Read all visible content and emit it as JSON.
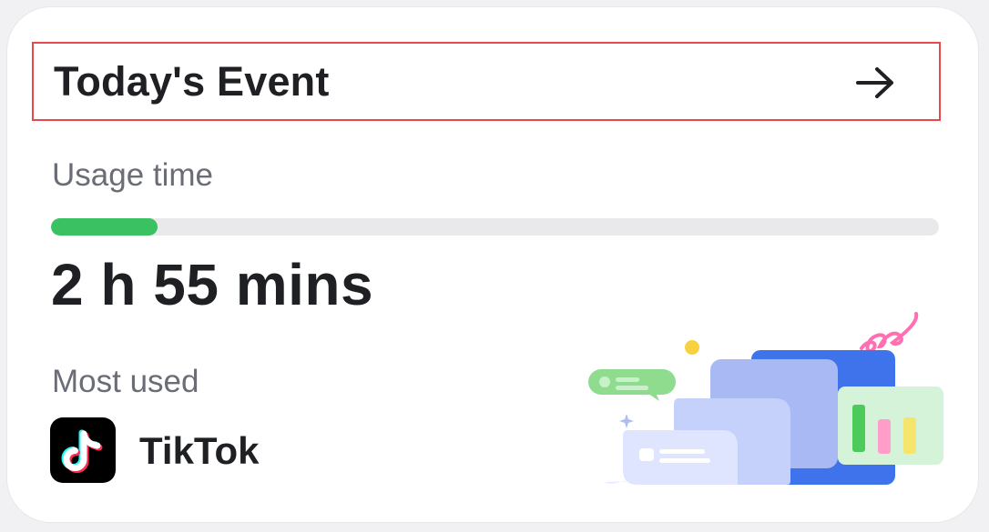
{
  "card": {
    "title": "Today's Event",
    "usage_label": "Usage time",
    "usage_progress_fraction": 0.12,
    "usage_time": "2 h 55 mins",
    "most_used_label": "Most used",
    "most_used_app": "TikTok"
  },
  "icons": {
    "arrow": "arrow-right-icon",
    "app": "tiktok-icon"
  },
  "colors": {
    "progress": "#3ac262",
    "highlight_border": "#e5484d",
    "illustration_blue": "#3f73ec"
  }
}
